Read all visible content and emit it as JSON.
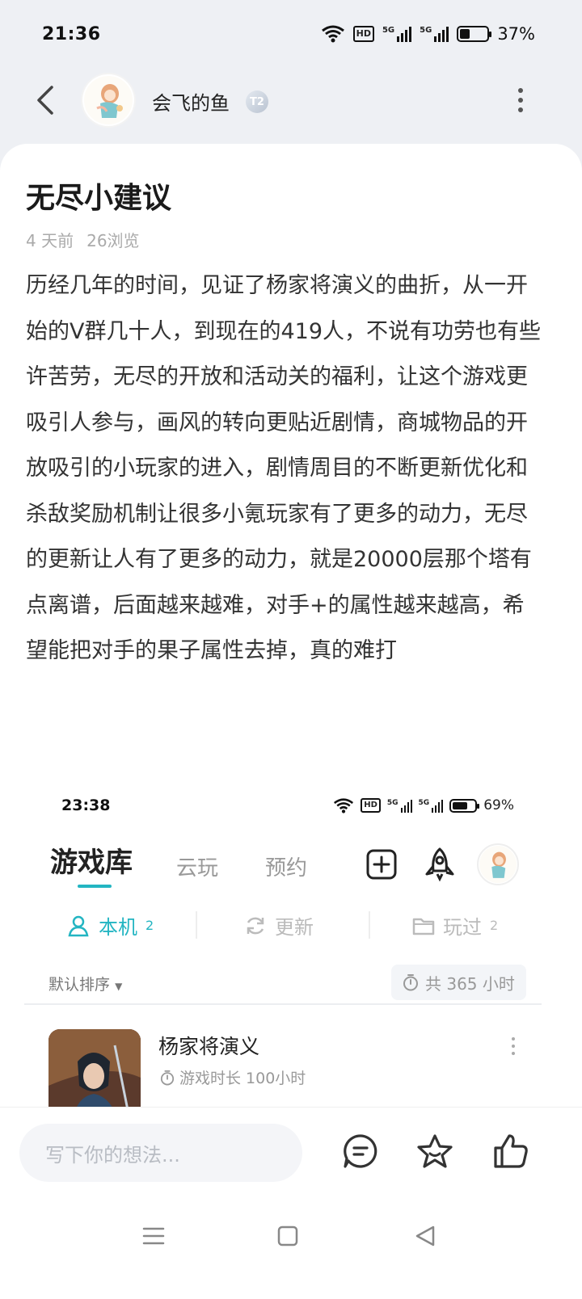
{
  "status_bar": {
    "time": "21:36",
    "hd_label": "HD",
    "signal_1": "5G",
    "signal_2": "5G",
    "battery_percent_text": "37%",
    "battery_level": 0.37
  },
  "header": {
    "username": "会飞的鱼",
    "level_badge": "T2"
  },
  "post": {
    "title": "无尽小建议",
    "time_ago": "4 天前",
    "views": "26浏览",
    "body": "历经几年的时间，见证了杨家将演义的曲折，从一开始的V群几十人，到现在的419人，不说有功劳也有些许苦劳，无尽的开放和活动关的福利，让这个游戏更吸引人参与，画风的转向更贴近剧情，商城物品的开放吸引的小玩家的进入，剧情周目的不断更新优化和杀敌奖励机制让很多小氪玩家有了更多的动力，无尽的更新让人有了更多的动力，就是20000层那个塔有点离谱，后面越来越难，对手+的属性越来越高，希望能把对手的果子属性去掉，真的难打"
  },
  "screenshot": {
    "status": {
      "time": "23:38",
      "hd_label": "HD",
      "signal_1": "5G",
      "signal_2": "5G",
      "battery_percent_text": "69%",
      "battery_level": 0.69
    },
    "tabs": [
      "游戏库",
      "云玩",
      "预约"
    ],
    "subtabs": [
      {
        "label": "本机",
        "count": "2"
      },
      {
        "label": "更新",
        "count": ""
      },
      {
        "label": "玩过",
        "count": "2"
      }
    ],
    "sort_label": "默认排序",
    "total_hours": "共 365 小时",
    "game": {
      "name": "杨家将演义",
      "playtime": "游戏时长 100小时"
    }
  },
  "action_bar": {
    "comment_placeholder": "写下你的想法..."
  },
  "colors": {
    "accent": "#23b5c2",
    "page_bg": "#eef0f4",
    "muted_text": "#aaaaaa"
  },
  "icons": [
    "wifi-icon",
    "back-arrow-icon",
    "more-vertical-icon",
    "add-square-icon",
    "rocket-icon",
    "user-icon",
    "refresh-icon",
    "folder-icon",
    "timer-icon",
    "comment-icon",
    "star-icon",
    "thumbs-up-icon",
    "menu-icon",
    "home-square-icon",
    "back-triangle-icon"
  ]
}
